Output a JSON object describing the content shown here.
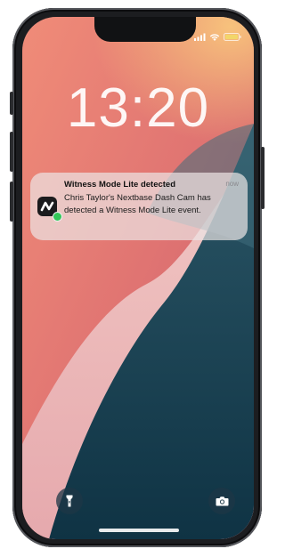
{
  "lock_screen": {
    "time": "13:20"
  },
  "notification": {
    "title": "Witness Mode Lite detected",
    "time": "now",
    "body": "Chris Taylor's Nextbase Dash Cam has detected a Witness Mode Lite event.",
    "app_icon": "nextbase-icon",
    "badge_icon": "messages-badge-icon"
  },
  "controls": {
    "left_icon": "flashlight-icon",
    "right_icon": "camera-icon"
  },
  "status": {
    "icons": [
      "cellular-signal-icon",
      "wifi-icon",
      "battery-icon"
    ]
  },
  "colors": {
    "badge": "#34c759",
    "wallpaper_coral": "#e47c74",
    "wallpaper_teal": "#1f4b5c",
    "battery": "#f2d66a"
  }
}
